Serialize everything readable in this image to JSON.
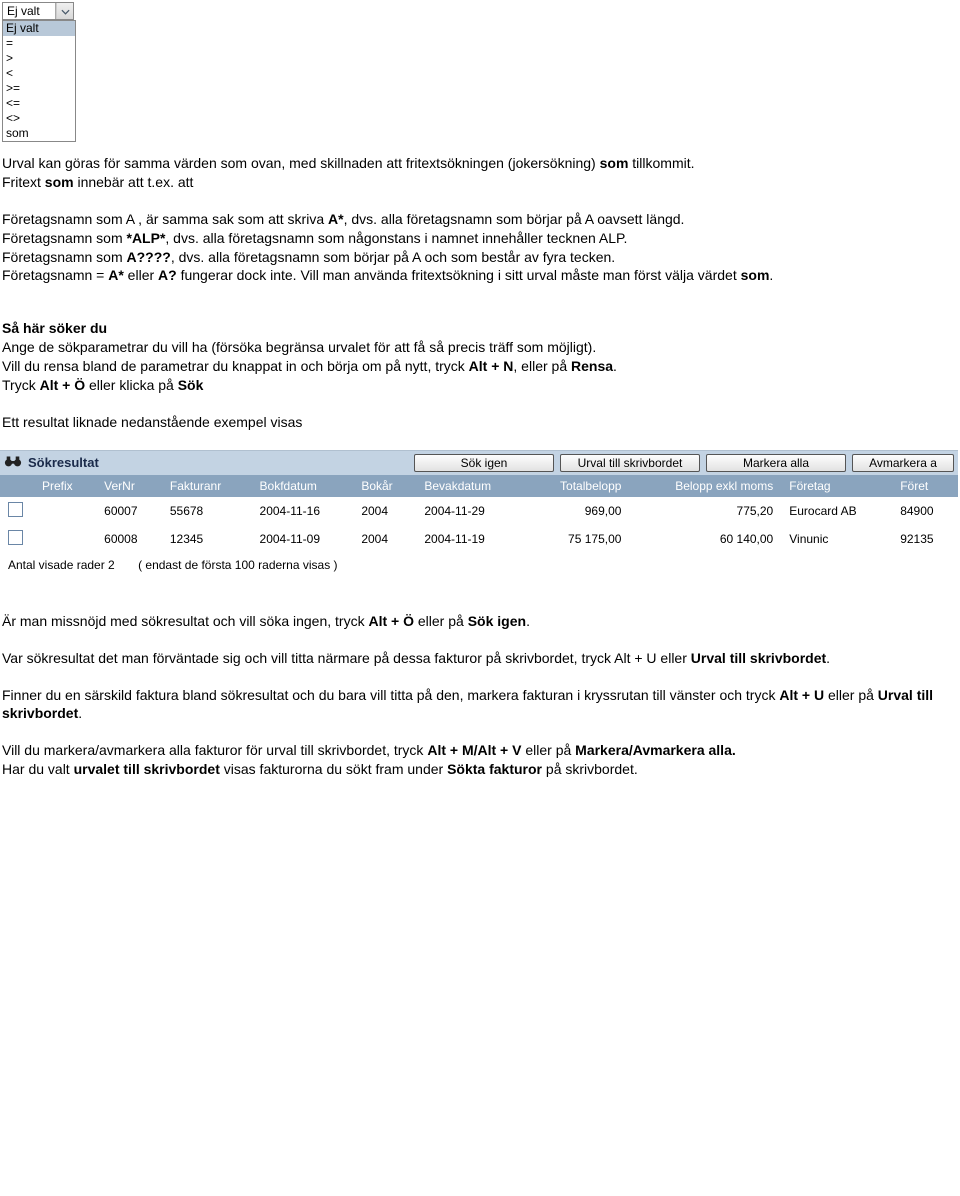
{
  "dropdown": {
    "selected": "Ej valt",
    "options": [
      "Ej valt",
      "=",
      ">",
      "<",
      ">=",
      "<=",
      "<>",
      "som"
    ]
  },
  "content": {
    "p1a": "Urval kan göras för samma värden som ovan, med skillnaden att fritextsökningen (jokersökning) ",
    "p1b": "som",
    "p1c": " tillkommit.",
    "p2a": "Fritext ",
    "p2b": "som",
    "p2c": " innebär att t.ex. att",
    "p3a": "Företagsnamn som A",
    "p3b": " , är samma sak som att skriva ",
    "p3c": "A*",
    "p3d": ", dvs. alla företagsnamn som börjar på A oavsett längd.",
    "p4a": "Företagsnamn som ",
    "p4b": "*ALP*",
    "p4c": ", dvs. alla företagsnamn som någonstans i namnet innehåller tecknen ALP.",
    "p5a": "Företagsnamn som ",
    "p5b": "A????",
    "p5c": ", dvs. alla företagsnamn som börjar på A och som består av fyra tecken.",
    "p6a": "Företagsnamn = ",
    "p6b": "A*",
    "p6c": " eller ",
    "p6d": "A?",
    "p6e": " fungerar dock inte. Vill man använda fritextsökning i sitt urval måste man först välja värdet ",
    "p6f": "som",
    "p6g": ".",
    "p7a": "Så här söker du",
    "p7b": "Ange de sökparametrar du vill ha (försöka begränsa urvalet för att få så precis träff som möjligt).",
    "p7c": "Vill du rensa bland de parametrar du knappat in och börja om på nytt, tryck ",
    "p7d": "Alt + N",
    "p7e": ", eller på ",
    "p7f": "Rensa",
    "p7g": ".",
    "p7h": "Tryck ",
    "p7i": "Alt + Ö",
    "p7j": " eller klicka på ",
    "p7k": "Sök",
    "p8": "Ett resultat liknade nedanstående exempel visas"
  },
  "sok": {
    "title": "Sökresultat",
    "buttons": {
      "again": "Sök igen",
      "urval": "Urval till skrivbordet",
      "mark": "Markera alla",
      "unmark": "Avmarkera a"
    },
    "headers": [
      "Prefix",
      "VerNr",
      "Fakturanr",
      "Bokfdatum",
      "Bokår",
      "Bevakdatum",
      "Totalbelopp",
      "Belopp exkl moms",
      "Företag",
      "Föret"
    ],
    "rows": [
      {
        "prefix": "",
        "vernr": "60007",
        "fakturanr": "55678",
        "bokfdatum": "2004-11-16",
        "bokar": "2004",
        "bevak": "2004-11-29",
        "total": "969,00",
        "exkl": "775,20",
        "foretag": "Eurocard AB",
        "foret": "84900"
      },
      {
        "prefix": "",
        "vernr": "60008",
        "fakturanr": "12345",
        "bokfdatum": "2004-11-09",
        "bokar": "2004",
        "bevak": "2004-11-19",
        "total": "75 175,00",
        "exkl": "60 140,00",
        "foretag": "Vinunic",
        "foret": "92135"
      }
    ],
    "footer_a": "Antal visade rader  2",
    "footer_b": "( endast de första 100 raderna visas )"
  },
  "below": {
    "p1a": "Är man missnöjd med sökresultat och vill söka ingen, tryck ",
    "p1b": "Alt + Ö",
    "p1c": " eller på ",
    "p1d": "Sök igen",
    "p1e": ".",
    "p2a": "Var sökresultat det man förväntade sig och vill titta närmare på dessa fakturor på skrivbordet, tryck Alt + U eller ",
    "p2b": "Urval till skrivbordet",
    "p2c": ".",
    "p3a": "Finner du en särskild faktura bland sökresultat och du bara vill titta på den, markera fakturan i kryssrutan till vänster och tryck ",
    "p3b": "Alt + U",
    "p3c": " eller på ",
    "p3d": "Urval till skrivbordet",
    "p3e": ".",
    "p4a": "Vill du markera/avmarkera alla fakturor för urval till skrivbordet, tryck ",
    "p4b": "Alt + M/Alt + V",
    "p4c": " eller på ",
    "p4d": "Markera/Avmarkera alla.",
    "p5a": "Har du valt ",
    "p5b": "urvalet till skrivbordet",
    "p5c": " visas fakturorna du sökt fram under ",
    "p5d": "Sökta fakturor",
    "p5e": " på skrivbordet."
  }
}
